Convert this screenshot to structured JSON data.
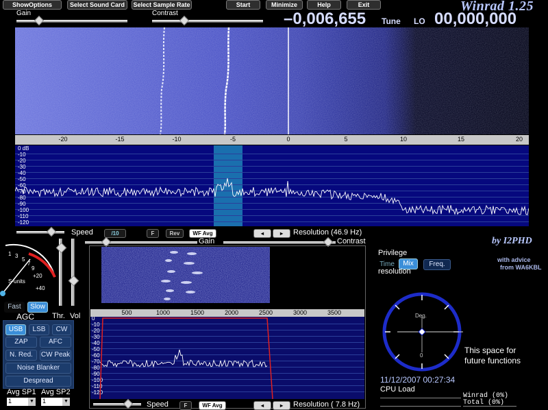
{
  "top_buttons": [
    "ShowOptions",
    "Select Sound Card",
    "Select Sample Rate",
    "Start",
    "Minimize",
    "Help",
    "Exit"
  ],
  "app_title": "Winrad 1.25",
  "labels": {
    "gain": "Gain",
    "contrast": "Contrast"
  },
  "frequency": {
    "tune_value": "–0,006,655",
    "tune_label": "Tune",
    "lo_label": "LO",
    "lo_value": "00,000,000"
  },
  "top_scale_ticks": [
    "-20",
    "-15",
    "-10",
    "-5",
    "0",
    "5",
    "10",
    "15",
    "20"
  ],
  "top_db_labels": [
    "0 dB",
    "-10",
    "-20",
    "-30",
    "-40",
    "-50",
    "-60",
    "-70",
    "-80",
    "-90",
    "-100",
    "-110",
    "-120"
  ],
  "spectrum_controls": {
    "speed_label": "Speed",
    "speed_value": "/10",
    "f_btn": "F",
    "rev_btn": "Rev",
    "wfavg_btn": "WF Avg",
    "resolution": "Resolution (46.9 Hz)"
  },
  "mid_labels": {
    "gain": "Gain",
    "contrast": "Contrast"
  },
  "smeter": {
    "scale": [
      "1",
      "3",
      "5",
      "7",
      "9",
      "+20",
      "+40"
    ],
    "units": "S-units"
  },
  "agc": {
    "fast": "Fast",
    "slow": "Slow",
    "label": "AGC",
    "thr": "Thr.",
    "vol": "Vol"
  },
  "modes": {
    "usb": "USB",
    "lsb": "LSB",
    "cw": "CW",
    "zap": "ZAP",
    "afc": "AFC",
    "nred": "N. Red.",
    "cwpeak": "CW Peak",
    "nb": "Noise Blanker",
    "despread": "Despread"
  },
  "avg": {
    "sp1_label": "Avg SP1",
    "sp2_label": "Avg SP2",
    "sp1_value": "1",
    "sp2_value": "1"
  },
  "bottom_scale_ticks": [
    "500",
    "1000",
    "1500",
    "2000",
    "2500",
    "3000",
    "3500"
  ],
  "bottom_db_labels": [
    "0",
    "-10",
    "-20",
    "-30",
    "-40",
    "-50",
    "-60",
    "-70",
    "-80",
    "-90",
    "-100",
    "-110",
    "-120"
  ],
  "bottom_controls": {
    "speed_label": "Speed",
    "f_btn": "F",
    "wfavg_btn": "WF Avg",
    "resolution": "Resolution ( 7.8 Hz)"
  },
  "right_panel": {
    "author": "by I2PHD",
    "privilege": "Privilege",
    "time": "Time",
    "mix": "Mix",
    "freq": "Freq.",
    "resolution": "resolution",
    "advice1": "with advice",
    "advice2": "from WA6KBL",
    "deg_label": "Deg.",
    "deg_value": "0",
    "future1": "This space for",
    "future2": "future functions",
    "datetime": "11/12/2007 00:27:34",
    "cpu_load": "CPU Load",
    "winrad_load": "Winrad  (0%)",
    "total_load": "Total   (0%)"
  },
  "colors": {
    "waterfall": "#4a52c8",
    "spectrum_bg": "#06087e",
    "highlight": "#1a6fae",
    "accent": "#3b8fd9"
  }
}
